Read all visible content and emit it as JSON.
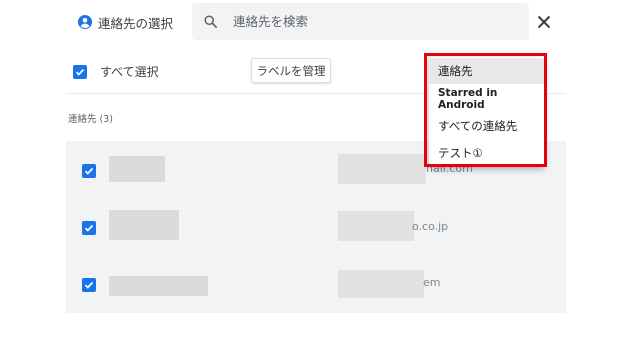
{
  "header": {
    "title": "連絡先の選択",
    "search_placeholder": "連絡先を検索"
  },
  "toolbar": {
    "select_all_label": "すべて選択",
    "select_all_checked": true,
    "manage_labels_button": "ラベルを管理"
  },
  "contacts": {
    "section_label": "連絡先 (3)",
    "rows": [
      {
        "checked": true,
        "email_tail": "nail.com"
      },
      {
        "checked": true,
        "email_tail": "o.co.jp"
      },
      {
        "checked": true,
        "email_tail": "em"
      }
    ]
  },
  "label_menu": {
    "items": [
      {
        "label": "連絡先",
        "selected": true
      },
      {
        "label": "Starred in Android",
        "selected": false
      },
      {
        "label": "すべての連絡先",
        "selected": false
      },
      {
        "label": "テスト①",
        "selected": false
      }
    ]
  },
  "colors": {
    "accent": "#1a73e8",
    "highlight": "#e8000b",
    "list_bg": "#f1f3f4"
  },
  "icons": [
    "person-circle-icon",
    "search-icon",
    "close-icon",
    "checkbox-checked-icon"
  ]
}
